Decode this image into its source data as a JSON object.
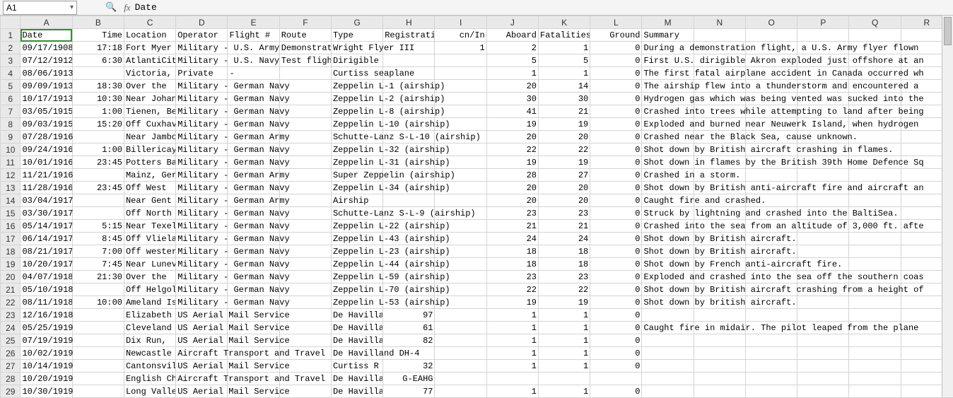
{
  "formula_bar": {
    "name_box": "A1",
    "dropdown_glyph": "▾",
    "magnifier_glyph": "🔍",
    "fx_label": "fx",
    "value": "Date"
  },
  "columns": [
    "A",
    "B",
    "C",
    "D",
    "E",
    "F",
    "G",
    "H",
    "I",
    "J",
    "K",
    "L",
    "M",
    "N",
    "O",
    "P",
    "Q",
    "R"
  ],
  "headers": {
    "A": "Date",
    "B": "Time",
    "C": "Location",
    "D": "Operator",
    "E": "Flight #",
    "F": "Route",
    "G": "Type",
    "H": "Registration",
    "I": "cn/In",
    "J": "Aboard",
    "K": "Fatalities",
    "L": "Ground",
    "M": "Summary"
  },
  "rows": [
    {
      "n": 1
    },
    {
      "n": 2,
      "A": "09/17/1908",
      "B": "17:18",
      "C": "Fort Myer",
      "D": "Military - U.S. Army",
      "F": "Demonstration",
      "G": "Wright Flyer III",
      "I": "1",
      "J": "2",
      "K": "1",
      "L": "0",
      "M": "During a demonstration flight, a U.S. Army flyer flown"
    },
    {
      "n": 3,
      "A": "07/12/1912",
      "B": "6:30",
      "C": "AtlantiCity",
      "D": "Military - U.S. Navy",
      "F": "Test flight",
      "G": "Dirigible",
      "J": "5",
      "K": "5",
      "L": "0",
      "M": "First U.S. dirigible Akron exploded just offshore at an"
    },
    {
      "n": 4,
      "A": "08/06/1913",
      "C": "Victoria,",
      "D": "Private",
      "E": "-",
      "G": "Curtiss seaplane",
      "J": "1",
      "K": "1",
      "L": "0",
      "M": "The first fatal airplane accident in Canada occurred wh"
    },
    {
      "n": 5,
      "A": "09/09/1913",
      "B": "18:30",
      "C": "Over the",
      "D": "Military - German Navy",
      "G": "Zeppelin L-1 (airship)",
      "J": "20",
      "K": "14",
      "L": "0",
      "M": "The airship flew into a thunderstorm and encountered a"
    },
    {
      "n": 6,
      "A": "10/17/1913",
      "B": "10:30",
      "C": "Near Johannisthal",
      "D": "Military - German Navy",
      "G": "Zeppelin L-2 (airship)",
      "J": "30",
      "K": "30",
      "L": "0",
      "M": "Hydrogen gas which was being vented was sucked into the"
    },
    {
      "n": 7,
      "A": "03/05/1915",
      "B": "1:00",
      "C": "Tienen, Belgium",
      "D": "Military - German Navy",
      "G": "Zeppelin L-8 (airship)",
      "J": "41",
      "K": "21",
      "L": "0",
      "M": "Crashed into trees while attempting to land after being"
    },
    {
      "n": 8,
      "A": "09/03/1915",
      "B": "15:20",
      "C": "Off Cuxhaven",
      "D": "Military - German Navy",
      "G": "Zeppelin L-10 (airship)",
      "J": "19",
      "K": "19",
      "L": "0",
      "M": "Exploded and burned near Neuwerk Island,  when hydrogen"
    },
    {
      "n": 9,
      "A": "07/28/1916",
      "C": "Near Jambol",
      "D": "Military - German Army",
      "G": "Schutte-Lanz S-L-10 (airship)",
      "J": "20",
      "K": "20",
      "L": "0",
      "M": "Crashed near the Black Sea, cause unknown."
    },
    {
      "n": 10,
      "A": "09/24/1916",
      "B": "1:00",
      "C": "Billericay",
      "D": "Military - German Navy",
      "G": "Zeppelin L-32 (airship)",
      "J": "22",
      "K": "22",
      "L": "0",
      "M": "Shot down by British aircraft crashing in flames."
    },
    {
      "n": 11,
      "A": "10/01/1916",
      "B": "23:45",
      "C": "Potters Bar",
      "D": "Military - German Navy",
      "G": "Zeppelin L-31 (airship)",
      "J": "19",
      "K": "19",
      "L": "0",
      "M": "Shot down in flames by the British 39th Home Defence Sq"
    },
    {
      "n": 12,
      "A": "11/21/1916",
      "C": "Mainz, Germany",
      "D": "Military - German Army",
      "G": "Super Zeppelin (airship)",
      "J": "28",
      "K": "27",
      "L": "0",
      "M": "Crashed in a storm."
    },
    {
      "n": 13,
      "A": "11/28/1916",
      "B": "23:45",
      "C": "Off West",
      "D": "Military - German Navy",
      "G": "Zeppelin L-34 (airship)",
      "J": "20",
      "K": "20",
      "L": "0",
      "M": "Shot down by British anti-aircraft fire and aircraft an"
    },
    {
      "n": 14,
      "A": "03/04/1917",
      "C": "Near Gent",
      "D": "Military - German Army",
      "G": "Airship",
      "J": "20",
      "K": "20",
      "L": "0",
      "M": "Caught fire and crashed."
    },
    {
      "n": 15,
      "A": "03/30/1917",
      "C": "Off North",
      "D": "Military - German Navy",
      "G": "Schutte-Lanz S-L-9 (airship)",
      "J": "23",
      "K": "23",
      "L": "0",
      "M": "Struck by lightning and crashed into the BaltiSea."
    },
    {
      "n": 16,
      "A": "05/14/1917",
      "B": "5:15",
      "C": "Near Texel",
      "D": "Military - German Navy",
      "G": "Zeppelin L-22 (airship)",
      "J": "21",
      "K": "21",
      "L": "0",
      "M": "Crashed into the sea from an altitude of 3,000 ft. afte"
    },
    {
      "n": 17,
      "A": "06/14/1917",
      "B": "8:45",
      "C": "Off Vlieland",
      "D": "Military - German Navy",
      "G": "Zeppelin L-43 (airship)",
      "J": "24",
      "K": "24",
      "L": "0",
      "M": "Shot down by British aircraft."
    },
    {
      "n": 18,
      "A": "08/21/1917",
      "B": "7:00",
      "C": "Off western",
      "D": "Military - German Navy",
      "G": "Zeppelin L-23 (airship)",
      "J": "18",
      "K": "18",
      "L": "0",
      "M": "Shot down by British aircraft."
    },
    {
      "n": 19,
      "A": "10/20/1917",
      "B": "7:45",
      "C": "Near Luneville",
      "D": "Military - German Navy",
      "G": "Zeppelin L-44 (airship)",
      "J": "18",
      "K": "18",
      "L": "0",
      "M": "Shot down by French anti-aircraft fire."
    },
    {
      "n": 20,
      "A": "04/07/1918",
      "B": "21:30",
      "C": "Over the",
      "D": "Military - German Navy",
      "G": "Zeppelin L-59 (airship)",
      "J": "23",
      "K": "23",
      "L": "0",
      "M": "Exploded and crashed into the sea off the southern coas"
    },
    {
      "n": 21,
      "A": "05/10/1918",
      "C": "Off Helgoland",
      "D": "Military - German Navy",
      "G": "Zeppelin L-70 (airship)",
      "J": "22",
      "K": "22",
      "L": "0",
      "M": "Shot down by British aircraft crashing from a height of"
    },
    {
      "n": 22,
      "A": "08/11/1918",
      "B": "10:00",
      "C": "Ameland Island",
      "D": "Military - German Navy",
      "G": "Zeppelin L-53 (airship)",
      "J": "19",
      "K": "19",
      "L": "0",
      "M": "Shot down by british aircraft."
    },
    {
      "n": 23,
      "A": "12/16/1918",
      "C": "Elizabeth",
      "D": "US Aerial Mail Service",
      "G": "De Havilland",
      "H": "97",
      "J": "1",
      "K": "1",
      "L": "0"
    },
    {
      "n": 24,
      "A": "05/25/1919",
      "C": "Cleveland",
      "D": "US Aerial Mail Service",
      "G": "De Havilland",
      "H": "61",
      "J": "1",
      "K": "1",
      "L": "0",
      "M": "Caught fire in midair. The pilot leaped from the plane"
    },
    {
      "n": 25,
      "A": "07/19/1919",
      "C": "Dix Run,",
      "D": "US Aerial Mail Service",
      "G": "De Havilland",
      "H": "82",
      "J": "1",
      "K": "1",
      "L": "0"
    },
    {
      "n": 26,
      "A": "10/02/1919",
      "C": "Newcastle",
      "D": "Aircraft Transport and Travel",
      "G": "De Havilland DH-4",
      "J": "1",
      "K": "1",
      "L": "0"
    },
    {
      "n": 27,
      "A": "10/14/1919",
      "C": "Cantonsville",
      "D": "US Aerial Mail Service",
      "G": "Curtiss R",
      "H": "32",
      "J": "1",
      "K": "1",
      "L": "0"
    },
    {
      "n": 28,
      "A": "10/20/1919",
      "C": "English Channel",
      "D": "Aircraft Transport and Travel",
      "G": "De Havilland",
      "H": "G-EAHG"
    },
    {
      "n": 29,
      "A": "10/30/1919",
      "C": "Long Valley",
      "D": "US Aerial Mail Service",
      "G": "De Havilland",
      "H": "77",
      "J": "1",
      "K": "1",
      "L": "0"
    }
  ],
  "selection": {
    "cell": "A1"
  }
}
